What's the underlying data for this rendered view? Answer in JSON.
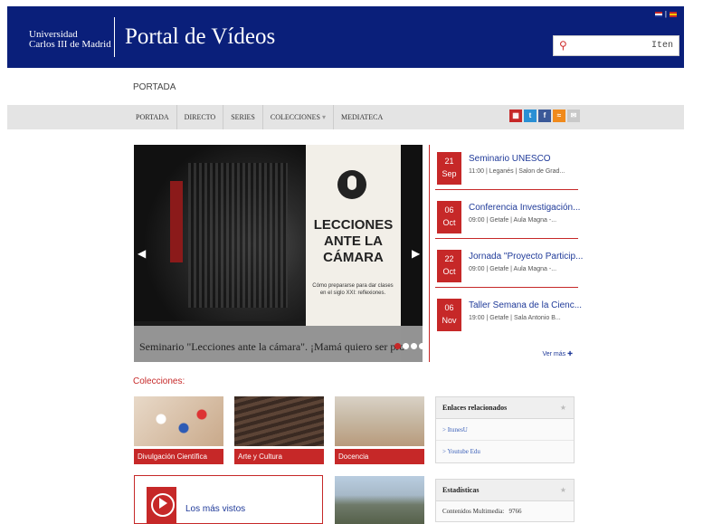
{
  "header": {
    "university_line1": "Universidad",
    "university_line2": "Carlos III de Madrid",
    "portal_title": "Portal de Vídeos",
    "search_text": "Iten",
    "brand_color": "#0a1f7a"
  },
  "breadcrumb": "PORTADA",
  "nav": {
    "items": [
      "PORTADA",
      "DIRECTO",
      "SERIES",
      "COLECCIONES",
      "MEDIATECA"
    ]
  },
  "social_icons": [
    "calendar-icon",
    "twitter-icon",
    "facebook-icon",
    "rss-icon",
    "email-icon"
  ],
  "slider": {
    "poster_title": "LECCIONES ANTE LA CÁMARA",
    "poster_subtitle": "Cómo prepararse para dar clases en el siglo XXI: reflexiones.",
    "caption": "Seminario \"Lecciones ante la cámara\". ¡Mamá quiero ser pro",
    "active_dot": 1,
    "dot_count": 4
  },
  "events": [
    {
      "day": "21",
      "month": "Sep",
      "title": "Seminario UNESCO",
      "sub": "11:00 | Leganés | Salon de Grad..."
    },
    {
      "day": "06",
      "month": "Oct",
      "title": "Conferencia Investigación...",
      "sub": "09:00 | Getafe | Aula Magna -..."
    },
    {
      "day": "22",
      "month": "Oct",
      "title": "Jornada \"Proyecto Particip...",
      "sub": "09:00 | Getafe | Aula Magna -..."
    },
    {
      "day": "06",
      "month": "Nov",
      "title": "Taller Semana de la Cienc...",
      "sub": "19:00 | Getafe | Sala Antonio B..."
    }
  ],
  "events_more": "Ver más",
  "colecciones": {
    "title": "Colecciones:",
    "tiles": [
      "Divulgación Científica",
      "Arte y Cultura",
      "Docencia"
    ]
  },
  "enlaces": {
    "title": "Enlaces relacionados",
    "links": [
      "> ItunesU",
      "> Youtube Edu"
    ]
  },
  "estadisticas": {
    "title": "Estadísticas",
    "label": "Contenidos Multimedia:",
    "value": "9766"
  },
  "most_viewed": "Los más vistos",
  "accent_color": "#c62828"
}
